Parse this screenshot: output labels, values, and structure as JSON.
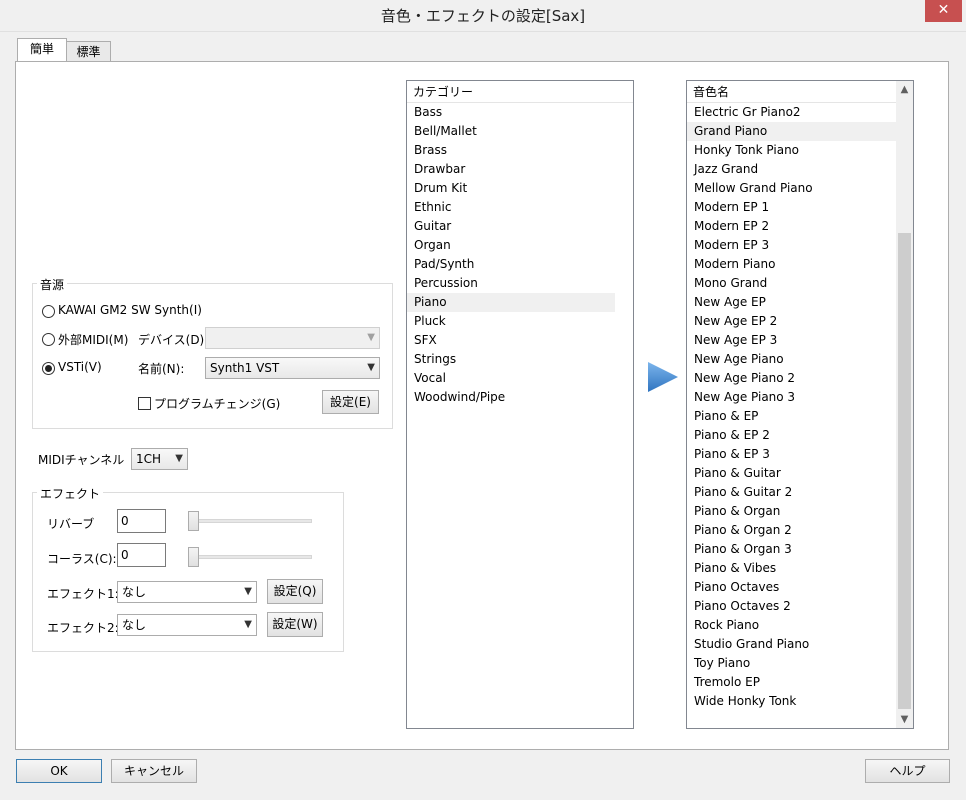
{
  "window": {
    "title": "音色・エフェクトの設定[Sax]",
    "close_label": "✕"
  },
  "tabs": [
    {
      "label": "簡単"
    },
    {
      "label": "標準"
    }
  ],
  "sound_source": {
    "legend": "音源",
    "kawai_label": "KAWAI GM2 SW Synth(I)",
    "external_midi_label": "外部MIDI(M)",
    "device_label": "デバイス(D):",
    "device_value": "",
    "vsti_label": "VSTi(V)",
    "name_label": "名前(N):",
    "name_value": "Synth1 VST",
    "program_change_label": "プログラムチェンジ(G)",
    "settings_e_label": "設定(E)"
  },
  "midi_channel": {
    "label": "MIDIチャンネル",
    "value": "1CH"
  },
  "effects": {
    "legend": "エフェクト",
    "reverb_label": "リバーブ",
    "reverb_value": "0",
    "chorus_label": "コーラス(C):",
    "chorus_value": "0",
    "effect1_label": "エフェクト1:",
    "effect1_value": "なし",
    "effect1_settings_label": "設定(Q)",
    "effect2_label": "エフェクト2:",
    "effect2_value": "なし",
    "effect2_settings_label": "設定(W)"
  },
  "category_list": {
    "header": "カテゴリー",
    "items": [
      "Bass",
      "Bell/Mallet",
      "Brass",
      "Drawbar",
      "Drum Kit",
      "Ethnic",
      "Guitar",
      "Organ",
      "Pad/Synth",
      "Percussion",
      "Piano",
      "Pluck",
      "SFX",
      "Strings",
      "Vocal",
      "Woodwind/Pipe"
    ],
    "selected": "Piano"
  },
  "tone_list": {
    "header": "音色名",
    "items": [
      "Electric Gr Piano2",
      "Grand Piano",
      "Honky Tonk Piano",
      "Jazz Grand",
      "Mellow Grand Piano",
      "Modern EP 1",
      "Modern EP 2",
      "Modern EP 3",
      "Modern Piano",
      "Mono Grand",
      "New Age EP",
      "New Age EP 2",
      "New Age EP 3",
      "New Age Piano",
      "New Age Piano 2",
      "New Age Piano 3",
      "Piano & EP",
      "Piano & EP 2",
      "Piano & EP 3",
      "Piano & Guitar",
      "Piano & Guitar 2",
      "Piano & Organ",
      "Piano & Organ 2",
      "Piano & Organ 3",
      "Piano & Vibes",
      "Piano Octaves",
      "Piano Octaves 2",
      "Rock Piano",
      "Studio Grand Piano",
      "Toy Piano",
      "Tremolo EP",
      "Wide Honky Tonk"
    ],
    "selected": "Grand Piano"
  },
  "footer": {
    "ok_label": "OK",
    "cancel_label": "キャンセル",
    "help_label": "ヘルプ"
  },
  "colors": {
    "accent": "#3c7fb1",
    "arrow": "#4a90d9",
    "close": "#c75050"
  }
}
